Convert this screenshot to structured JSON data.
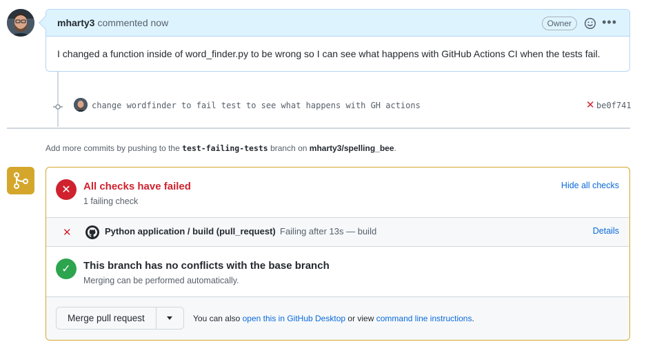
{
  "comment": {
    "author": "mharty3",
    "action": "commented now",
    "badge": "Owner",
    "body": "I changed a function inside of word_finder.py to be wrong so I can see what happens with GitHub Actions CI when the tests fail."
  },
  "commit": {
    "message": "change wordfinder to fail test to see what happens with GH actions",
    "sha": "be0f741",
    "status_icon": "x-icon"
  },
  "push_note": {
    "prefix": "Add more commits by pushing to the",
    "branch": "test-failing-tests",
    "middle": "branch on",
    "repo": "mharty3/spelling_bee",
    "suffix": "."
  },
  "checks": {
    "title": "All checks have failed",
    "subtitle": "1 failing check",
    "hide_label": "Hide all checks",
    "rows": [
      {
        "name": "Python application / build (pull_request)",
        "status": "Failing after 13s — build",
        "details_label": "Details"
      }
    ]
  },
  "conflicts": {
    "title": "This branch has no conflicts with the base branch",
    "subtitle": "Merging can be performed automatically."
  },
  "merge": {
    "button_label": "Merge pull request",
    "help_prefix": "You can also",
    "desktop_link": "open this in GitHub Desktop",
    "help_middle": "or view",
    "cli_link": "command line instructions",
    "help_suffix": "."
  },
  "colors": {
    "fail": "#cf222e",
    "success": "#2da44e",
    "warning_border": "#d4a72c",
    "link": "#0969da",
    "comment_header_bg": "#ddf4ff"
  }
}
